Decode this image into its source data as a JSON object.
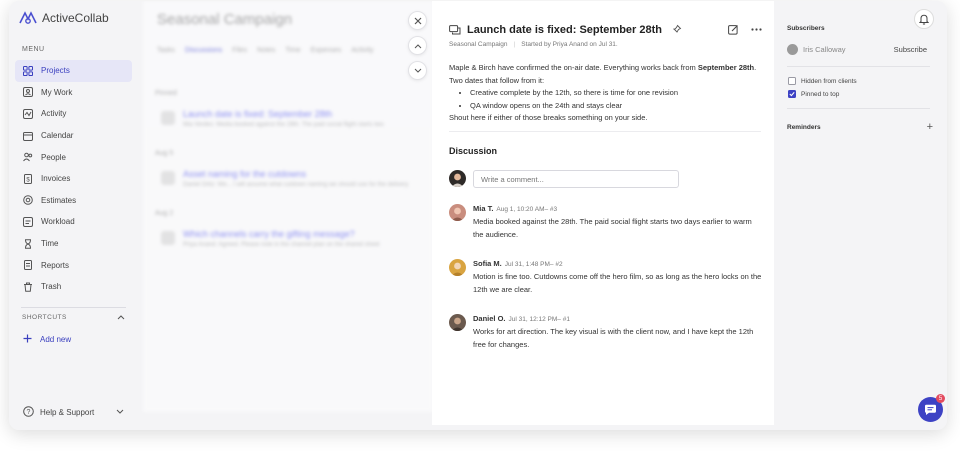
{
  "app": {
    "name": "ActiveCollab"
  },
  "sidebar": {
    "menu_label": "MENU",
    "items": [
      {
        "label": "Projects",
        "icon": "grid-icon",
        "active": true
      },
      {
        "label": "My Work",
        "icon": "person-card-icon"
      },
      {
        "label": "Activity",
        "icon": "activity-icon"
      },
      {
        "label": "Calendar",
        "icon": "calendar-icon"
      },
      {
        "label": "People",
        "icon": "people-icon"
      },
      {
        "label": "Invoices",
        "icon": "invoice-icon"
      },
      {
        "label": "Estimates",
        "icon": "estimate-icon"
      },
      {
        "label": "Workload",
        "icon": "workload-icon"
      },
      {
        "label": "Time",
        "icon": "hourglass-icon"
      },
      {
        "label": "Reports",
        "icon": "report-icon"
      },
      {
        "label": "Trash",
        "icon": "trash-icon"
      }
    ],
    "shortcuts_label": "SHORTCUTS",
    "add_new": "Add new",
    "help": "Help & Support"
  },
  "background": {
    "title": "Seasonal Campaign",
    "tabs": [
      "Tasks",
      "Discussions",
      "Files",
      "Notes",
      "Time",
      "Expenses",
      "Activity"
    ],
    "groups": [
      {
        "label": "Pinned",
        "title": "Launch date is fixed: September 28th",
        "sub": "Mia Verdes: Media booked against the 28th. The paid social flight starts two"
      },
      {
        "label": "Aug 5",
        "title": "Asset naming for the cutdowns",
        "sub": "Daniel Ortiz: We... I will assume what cutdown naming we should use for the delivery"
      },
      {
        "label": "Aug 2",
        "title": "Which channels carry the gifting message?",
        "sub": "Priya Anand: Agreed. Please note in the channel plan on the shared sheet"
      }
    ]
  },
  "discussion": {
    "title": "Launch date is fixed: September 28th",
    "project": "Seasonal Campaign",
    "started_by": "Started by Priya Anand on Jul 31.",
    "body_p1_a": "Maple & Birch have confirmed the on-air date. Everything works back from ",
    "body_p1_bold": "September 28th",
    "body_p1_b": ". Two dates that follow from it:",
    "bullets": [
      "Creative complete by the 12th, so there is time for one revision",
      "QA window opens on the 24th and stays clear"
    ],
    "body_p2": "Shout here if either of those breaks something on your side.",
    "discussion_label": "Discussion",
    "comment_placeholder": "Write a comment...",
    "comments": [
      {
        "author": "Mia T.",
        "meta": "Aug 1, 10:20 AM– #3",
        "text": "Media booked against the 28th. The paid social flight starts two days earlier to warm the audience.",
        "avatar_color": "#c98d7e"
      },
      {
        "author": "Sofia M.",
        "meta": "Jul 31, 1:48 PM– #2",
        "text": "Motion is fine too. Cutdowns come off the hero film, so as long as the hero locks on the 12th we are clear.",
        "avatar_color": "#d9a441"
      },
      {
        "author": "Daniel O.",
        "meta": "Jul 31, 12:12 PM– #1",
        "text": "Works for art direction. The key visual is with the client now, and I have kept the 12th free for changes.",
        "avatar_color": "#6b5a4e"
      }
    ]
  },
  "right": {
    "subscribers_label": "Subscribers",
    "subscriber": "Iris Calloway",
    "subscribe": "Subscribe",
    "hidden_from_clients": "Hidden from clients",
    "pinned_to_top": "Pinned to top",
    "reminders_label": "Reminders"
  },
  "chat_badge": "5",
  "colors": {
    "accent": "#3d42c4",
    "active_bg": "#e6e6f7"
  }
}
